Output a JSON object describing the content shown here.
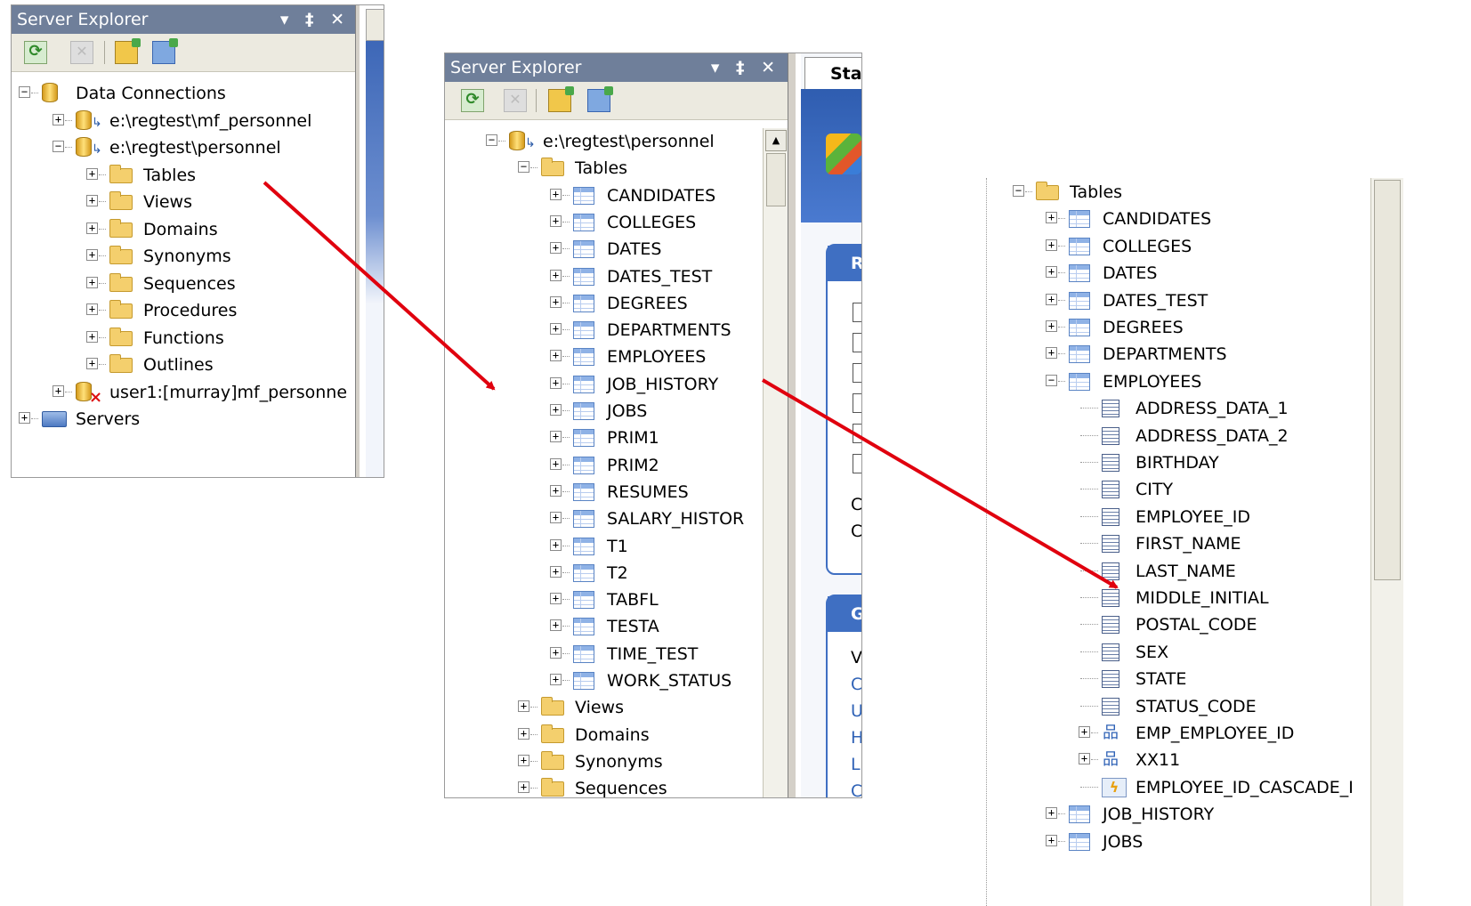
{
  "panel1": {
    "title": "Server Explorer",
    "title_controls": "▾ ‡ ✕",
    "tree": [
      {
        "label": "Data Connections",
        "indent": 0,
        "exp": "-",
        "icon": "data-connections-icon"
      },
      {
        "label": "e:\\regtest\\mf_personnel",
        "indent": 1,
        "exp": "+",
        "icon": "database-icon"
      },
      {
        "label": "e:\\regtest\\personnel",
        "indent": 1,
        "exp": "-",
        "icon": "database-icon"
      },
      {
        "label": "Tables",
        "indent": 2,
        "exp": "+",
        "icon": "folder-icon"
      },
      {
        "label": "Views",
        "indent": 2,
        "exp": "+",
        "icon": "folder-icon"
      },
      {
        "label": "Domains",
        "indent": 2,
        "exp": "+",
        "icon": "folder-icon"
      },
      {
        "label": "Synonyms",
        "indent": 2,
        "exp": "+",
        "icon": "folder-icon"
      },
      {
        "label": "Sequences",
        "indent": 2,
        "exp": "+",
        "icon": "folder-icon"
      },
      {
        "label": "Procedures",
        "indent": 2,
        "exp": "+",
        "icon": "folder-icon"
      },
      {
        "label": "Functions",
        "indent": 2,
        "exp": "+",
        "icon": "folder-icon"
      },
      {
        "label": "Outlines",
        "indent": 2,
        "exp": "+",
        "icon": "folder-icon"
      },
      {
        "label": "user1:[murray]mf_personne",
        "indent": 1,
        "exp": "+",
        "icon": "database-error-icon"
      },
      {
        "label": "Servers",
        "indent": 0,
        "exp": "+",
        "icon": "servers-icon"
      }
    ]
  },
  "panel2": {
    "title": "Server Explorer",
    "title_controls": "▾ ‡ ✕",
    "tab_label": "Sta",
    "tree": [
      {
        "label": "e:\\regtest\\personnel",
        "indent": 0,
        "exp": "-",
        "icon": "database-icon"
      },
      {
        "label": "Tables",
        "indent": 1,
        "exp": "-",
        "icon": "folder-icon"
      },
      {
        "label": "CANDIDATES",
        "indent": 2,
        "exp": "+",
        "icon": "table-icon"
      },
      {
        "label": "COLLEGES",
        "indent": 2,
        "exp": "+",
        "icon": "table-icon"
      },
      {
        "label": "DATES",
        "indent": 2,
        "exp": "+",
        "icon": "table-icon"
      },
      {
        "label": "DATES_TEST",
        "indent": 2,
        "exp": "+",
        "icon": "table-icon"
      },
      {
        "label": "DEGREES",
        "indent": 2,
        "exp": "+",
        "icon": "table-icon"
      },
      {
        "label": "DEPARTMENTS",
        "indent": 2,
        "exp": "+",
        "icon": "table-icon"
      },
      {
        "label": "EMPLOYEES",
        "indent": 2,
        "exp": "+",
        "icon": "table-icon"
      },
      {
        "label": "JOB_HISTORY",
        "indent": 2,
        "exp": "+",
        "icon": "table-icon"
      },
      {
        "label": "JOBS",
        "indent": 2,
        "exp": "+",
        "icon": "table-icon"
      },
      {
        "label": "PRIM1",
        "indent": 2,
        "exp": "+",
        "icon": "table-icon"
      },
      {
        "label": "PRIM2",
        "indent": 2,
        "exp": "+",
        "icon": "table-icon"
      },
      {
        "label": "RESUMES",
        "indent": 2,
        "exp": "+",
        "icon": "table-icon"
      },
      {
        "label": "SALARY_HISTOR",
        "indent": 2,
        "exp": "+",
        "icon": "table-icon"
      },
      {
        "label": "T1",
        "indent": 2,
        "exp": "+",
        "icon": "table-icon"
      },
      {
        "label": "T2",
        "indent": 2,
        "exp": "+",
        "icon": "table-icon"
      },
      {
        "label": "TABFL",
        "indent": 2,
        "exp": "+",
        "icon": "table-icon"
      },
      {
        "label": "TESTA",
        "indent": 2,
        "exp": "+",
        "icon": "table-icon"
      },
      {
        "label": "TIME_TEST",
        "indent": 2,
        "exp": "+",
        "icon": "table-icon"
      },
      {
        "label": "WORK_STATUS",
        "indent": 2,
        "exp": "+",
        "icon": "table-icon"
      },
      {
        "label": "Views",
        "indent": 1,
        "exp": "+",
        "icon": "folder-icon"
      },
      {
        "label": "Domains",
        "indent": 1,
        "exp": "+",
        "icon": "folder-icon"
      },
      {
        "label": "Synonyms",
        "indent": 1,
        "exp": "+",
        "icon": "folder-icon"
      },
      {
        "label": "Sequences",
        "indent": 1,
        "exp": "+",
        "icon": "folder-icon"
      }
    ],
    "start_page": {
      "section1_head": "R",
      "section1_lines": [
        "C",
        "C"
      ],
      "section2_head": "G",
      "section2_first": "V",
      "section2_links": [
        "C",
        "U",
        "H",
        "L",
        "C"
      ]
    }
  },
  "panel3": {
    "tree": [
      {
        "label": "Tables",
        "indent": 0,
        "exp": "-",
        "icon": "folder-icon"
      },
      {
        "label": "CANDIDATES",
        "indent": 1,
        "exp": "+",
        "icon": "table-icon"
      },
      {
        "label": "COLLEGES",
        "indent": 1,
        "exp": "+",
        "icon": "table-icon"
      },
      {
        "label": "DATES",
        "indent": 1,
        "exp": "+",
        "icon": "table-icon"
      },
      {
        "label": "DATES_TEST",
        "indent": 1,
        "exp": "+",
        "icon": "table-icon"
      },
      {
        "label": "DEGREES",
        "indent": 1,
        "exp": "+",
        "icon": "table-icon"
      },
      {
        "label": "DEPARTMENTS",
        "indent": 1,
        "exp": "+",
        "icon": "table-icon"
      },
      {
        "label": "EMPLOYEES",
        "indent": 1,
        "exp": "-",
        "icon": "table-icon"
      },
      {
        "label": "ADDRESS_DATA_1",
        "indent": 2,
        "exp": "",
        "icon": "column-icon"
      },
      {
        "label": "ADDRESS_DATA_2",
        "indent": 2,
        "exp": "",
        "icon": "column-icon"
      },
      {
        "label": "BIRTHDAY",
        "indent": 2,
        "exp": "",
        "icon": "column-icon"
      },
      {
        "label": "CITY",
        "indent": 2,
        "exp": "",
        "icon": "column-icon"
      },
      {
        "label": "EMPLOYEE_ID",
        "indent": 2,
        "exp": "",
        "icon": "column-icon"
      },
      {
        "label": "FIRST_NAME",
        "indent": 2,
        "exp": "",
        "icon": "column-icon"
      },
      {
        "label": "LAST_NAME",
        "indent": 2,
        "exp": "",
        "icon": "column-icon"
      },
      {
        "label": "MIDDLE_INITIAL",
        "indent": 2,
        "exp": "",
        "icon": "column-icon"
      },
      {
        "label": "POSTAL_CODE",
        "indent": 2,
        "exp": "",
        "icon": "column-icon"
      },
      {
        "label": "SEX",
        "indent": 2,
        "exp": "",
        "icon": "column-icon"
      },
      {
        "label": "STATE",
        "indent": 2,
        "exp": "",
        "icon": "column-icon"
      },
      {
        "label": "STATUS_CODE",
        "indent": 2,
        "exp": "",
        "icon": "column-icon"
      },
      {
        "label": "EMP_EMPLOYEE_ID",
        "indent": 2,
        "exp": "+",
        "icon": "index-icon"
      },
      {
        "label": "XX11",
        "indent": 2,
        "exp": "+",
        "icon": "index-icon"
      },
      {
        "label": "EMPLOYEE_ID_CASCADE_I",
        "indent": 2,
        "exp": "",
        "icon": "trigger-icon"
      },
      {
        "label": "JOB_HISTORY",
        "indent": 1,
        "exp": "+",
        "icon": "table-icon"
      },
      {
        "label": "JOBS",
        "indent": 1,
        "exp": "+",
        "icon": "table-icon"
      }
    ]
  },
  "colors": {
    "titlebar": "#6f7f9a",
    "arrow": "#e0000e",
    "start_page_blue": "#3f6fc2"
  }
}
